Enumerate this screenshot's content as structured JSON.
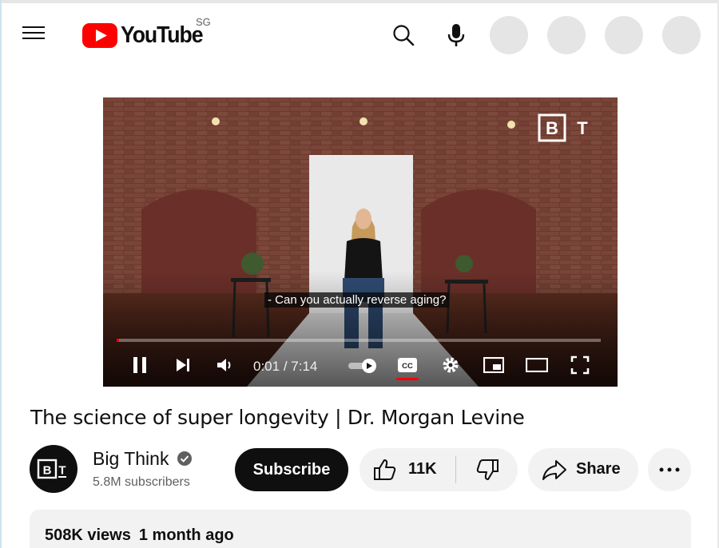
{
  "header": {
    "logo_text": "YouTube",
    "region_code": "SG",
    "icons": {
      "menu": "menu-icon",
      "search": "search-icon",
      "mic": "microphone-icon"
    },
    "brand_color": "#ff0000"
  },
  "player": {
    "subtitle": "- Can you actually reverse aging?",
    "watermark": "BT",
    "time_current": "0:01",
    "time_separator": " / ",
    "time_total": "7:14",
    "progress_fraction": 0.0023,
    "captions_on": true
  },
  "video": {
    "title": "The science of super longevity | Dr. Morgan Levine"
  },
  "channel": {
    "name": "Big Think",
    "subscribers": "5.8M subscribers",
    "avatar_text": "BT"
  },
  "actions": {
    "subscribe_label": "Subscribe",
    "like_count": "11K",
    "share_label": "Share"
  },
  "description": {
    "views": "508K views",
    "age": "1 month ago"
  }
}
